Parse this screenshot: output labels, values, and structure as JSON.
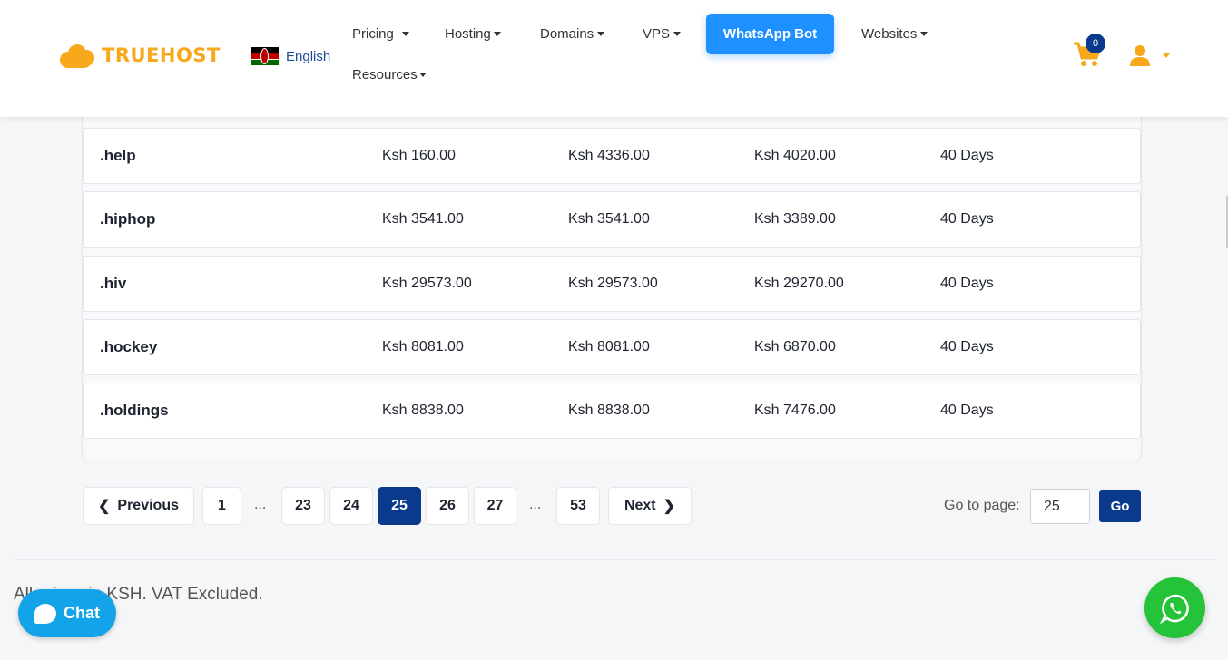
{
  "header": {
    "brand": "TRUEHOST",
    "language": "English",
    "nav": [
      {
        "label": "Pricing"
      },
      {
        "label": "Hosting"
      },
      {
        "label": "Domains"
      },
      {
        "label": "VPS"
      },
      {
        "label": "Websites"
      },
      {
        "label": "Resources"
      }
    ],
    "whatsapp_bot_label": "WhatsApp Bot",
    "cart_count": "0",
    "colors": {
      "brand": "#f7a81b",
      "accent": "#1e90ff",
      "primary": "#0a3a8c"
    }
  },
  "table": {
    "rows": [
      {
        "tld": ".help",
        "c1": "Ksh 160.00",
        "c2": "Ksh 4336.00",
        "c3": "Ksh 4020.00",
        "c4": "40 Days"
      },
      {
        "tld": ".hiphop",
        "c1": "Ksh 3541.00",
        "c2": "Ksh 3541.00",
        "c3": "Ksh 3389.00",
        "c4": "40 Days"
      },
      {
        "tld": ".hiv",
        "c1": "Ksh 29573.00",
        "c2": "Ksh 29573.00",
        "c3": "Ksh 29270.00",
        "c4": "40 Days"
      },
      {
        "tld": ".hockey",
        "c1": "Ksh 8081.00",
        "c2": "Ksh 8081.00",
        "c3": "Ksh 6870.00",
        "c4": "40 Days"
      },
      {
        "tld": ".holdings",
        "c1": "Ksh 8838.00",
        "c2": "Ksh 8838.00",
        "c3": "Ksh 7476.00",
        "c4": "40 Days"
      }
    ]
  },
  "pagination": {
    "previous_label": "Previous",
    "next_label": "Next",
    "pages": [
      "1",
      "23",
      "24",
      "25",
      "26",
      "27",
      "53"
    ],
    "ellipsis": "...",
    "current": "25",
    "goto_label": "Go to page:",
    "goto_value": "25",
    "go_label": "Go"
  },
  "footer": {
    "note": "All prices in KSH. VAT Excluded.",
    "chat_label": "Chat"
  }
}
